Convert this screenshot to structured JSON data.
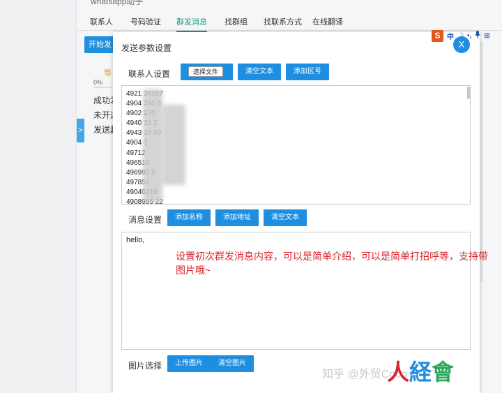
{
  "app": {
    "title": "whatsapp助手",
    "nav_tabs": [
      "联系人",
      "号码验证",
      "群发消息",
      "找群组",
      "找联系方式",
      "在线翻译"
    ],
    "start_button": "开始发",
    "waiting": "等",
    "progress_value": "0%",
    "status_lines": [
      "成功发",
      "未开通",
      "发送超"
    ],
    "side_handle": ">"
  },
  "ime": {
    "logo": "S",
    "items": [
      "中",
      "☽",
      "•,",
      "🎤",
      "⊞"
    ]
  },
  "modal": {
    "title": "发送参数设置",
    "close_label": "X",
    "contacts": {
      "label": "联系人设置",
      "choose_file": "选择文件",
      "clear_text": "清空文本",
      "add_area_code": "添加区号",
      "numbers": [
        "4921 36167",
        "4904 395 6",
        "4902 270",
        "4940 16 2",
        "4943 18 40",
        "4904 1",
        "49712",
        "496519",
        "496992 6",
        "497852",
        "49040219",
        "4908955 22"
      ]
    },
    "message": {
      "label": "消息设置",
      "add_name": "添加名称",
      "add_address": "添加地址",
      "clear_text": "清空文本",
      "content": "hello,"
    },
    "images": {
      "label": "图片选择",
      "upload": "上传图片",
      "clear": "清空图片"
    }
  },
  "annotation": "设置初次群发消息内容，可以是简单介绍，可以是简单打招呼等，支持带图片哦~",
  "watermark": "知乎 @外贸Coco",
  "logo": "人経會"
}
